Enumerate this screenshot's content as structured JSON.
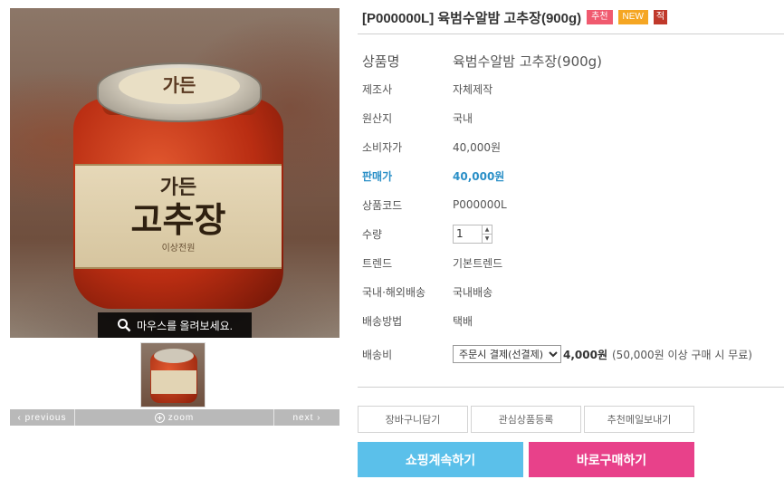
{
  "product": {
    "title": "[P000000L] 육범수알밤 고추장(900g)",
    "badges": {
      "recommend": "추천",
      "new": "NEW",
      "sale": "적"
    },
    "image": {
      "lid_text": "가든",
      "label_top": "가든",
      "label_main": "고추장",
      "label_sub": "이상전원",
      "mouseover_text": "마우스를 올려보세요."
    },
    "pager": {
      "previous": "‹ previous",
      "zoom": "zoom",
      "next": "next ›"
    }
  },
  "info": {
    "name_label": "상품명",
    "name_value": "육범수알밤 고추장(900g)",
    "maker_label": "제조사",
    "maker_value": "자체제작",
    "origin_label": "원산지",
    "origin_value": "국내",
    "consumer_price_label": "소비자가",
    "consumer_price_value": "40,000원",
    "sale_price_label": "판매가",
    "sale_price_value": "40,000원",
    "code_label": "상품코드",
    "code_value": "P000000L",
    "qty_label": "수량",
    "qty_value": "1",
    "trend_label": "트렌드",
    "trend_value": "기본트렌드",
    "shipping_scope_label": "국내·해외배송",
    "shipping_scope_value": "국내배송",
    "shipping_method_label": "배송방법",
    "shipping_method_value": "택배",
    "shipping_fee_label": "배송비",
    "shipping_fee_select": "주문시 결제(선결제)",
    "shipping_fee_value": "4,000원",
    "shipping_fee_note": "(50,000원 이상 구매 시 무료)"
  },
  "actions": {
    "cart": "장바구니담기",
    "wishlist": "관심상품등록",
    "recommend_mail": "추천메일보내기",
    "continue_shopping": "쇼핑계속하기",
    "buy_now": "바로구매하기"
  },
  "colors": {
    "sale_price": "#2a8fc7",
    "continue_button": "#5bc0ea",
    "buy_button": "#e8418a",
    "badge_recommend": "#f05a6f",
    "badge_new": "#f5a623"
  }
}
